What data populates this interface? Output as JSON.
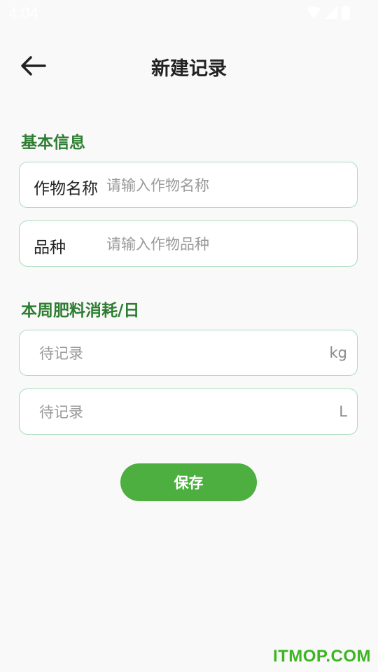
{
  "status_bar": {
    "time": "4:04",
    "icons": [
      "wifi-icon",
      "signal-icon",
      "battery-icon"
    ]
  },
  "header": {
    "back_icon": "back-arrow-icon",
    "title": "新建记录"
  },
  "basic_info": {
    "section_title": "基本信息",
    "crop_name": {
      "label": "作物名称",
      "value": "",
      "placeholder": "请输入作物名称"
    },
    "variety": {
      "label": "品种",
      "value": "",
      "placeholder": "请输入作物品种"
    }
  },
  "fertilizer": {
    "section_title": "本周肥料消耗/日",
    "solid": {
      "value": "",
      "placeholder": "待记录",
      "unit": "kg"
    },
    "liquid": {
      "value": "",
      "placeholder": "待记录",
      "unit": "L"
    }
  },
  "actions": {
    "save_label": "保存"
  },
  "watermark": "ITMOP.COM",
  "colors": {
    "accent": "#4caf3f",
    "section_title": "#2e7d32",
    "field_border": "#a8dcbc",
    "background": "#f9f9f9"
  }
}
